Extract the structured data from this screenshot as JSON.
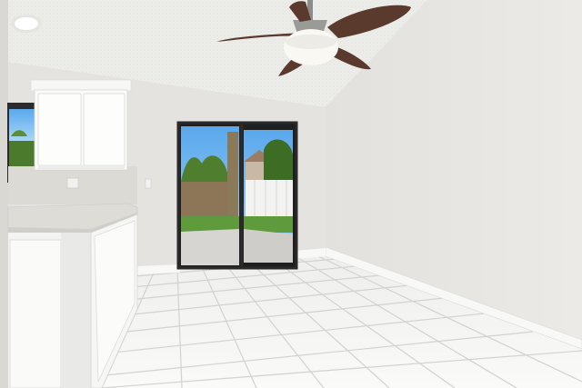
{
  "scene": {
    "kind": "photo",
    "subject": "empty-dining-room",
    "colors": {
      "ceiling": "#efefed",
      "wall_left": "#e3e2de",
      "wall_right": "#e6e5e1",
      "floor_tile": "#f4f4f2",
      "grout": "#cfd0cd",
      "baseboard": "#f7f7f5",
      "cabinet": "#fbfbfa",
      "countertop": "#dcdad5",
      "fan_blade": "#5a3a2c",
      "sky": "#7bbff2",
      "grass": "#5f9a3c",
      "fence": "#f3f3f1",
      "patio": "#d7d5d1"
    },
    "icons": [
      "ceiling-fan-icon",
      "recessed-light-icon"
    ]
  }
}
